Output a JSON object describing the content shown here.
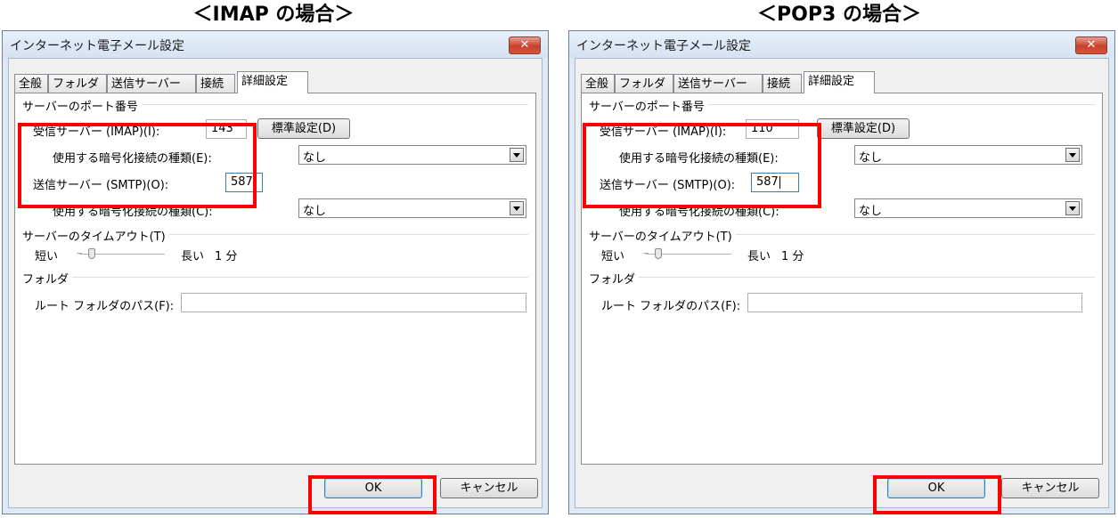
{
  "captions": {
    "left": "＜IMAP の場合＞",
    "right": "＜POP3 の場合＞"
  },
  "dialog": {
    "title": "インターネット電子メール設定",
    "close_label": "✕",
    "tabs": [
      "全般",
      "フォルダ",
      "送信サーバー",
      "接続",
      "詳細設定"
    ],
    "active_tab": "詳細設定",
    "port_group_label": "サーバーのポート番号",
    "incoming_label": "受信サーバー (IMAP)(I):",
    "default_button_label": "標準設定(D)",
    "incoming_encryption_label": "使用する暗号化接続の種類(E):",
    "outgoing_label": "送信サーバー (SMTP)(O):",
    "outgoing_port": "587",
    "outgoing_encryption_label": "使用する暗号化接続の種類(C):",
    "encryption_value": "なし",
    "timeout_group_label": "サーバーのタイムアウト(T)",
    "timeout_short": "短い",
    "timeout_long": "長い",
    "timeout_value": "1 分",
    "timeout_slider_level": 0.15,
    "folder_group_label": "フォルダ",
    "root_folder_label": "ルート フォルダのパス(F):",
    "root_folder_value": "",
    "ok_label": "OK",
    "cancel_label": "キャンセル"
  },
  "left": {
    "incoming_port": "143"
  },
  "right": {
    "incoming_port": "110"
  },
  "colors": {
    "highlight": "#ff0000",
    "close_button": "#c6422c",
    "dialog_frame": "#dfe9f5"
  }
}
